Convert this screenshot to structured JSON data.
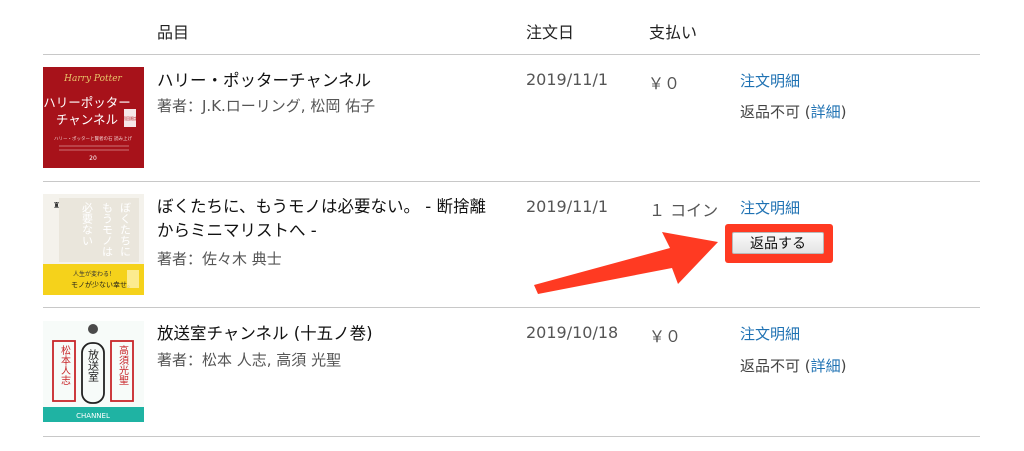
{
  "columns": {
    "item": "品目",
    "order_date": "注文日",
    "payment": "支払い"
  },
  "orders": [
    {
      "title": "ハリー・ポッターチャンネル",
      "author": "著者：J.K.ローリング, 松岡 佑子",
      "date": "2019/11/1",
      "payment": "￥０",
      "order_detail_link": "注文明細",
      "return_status": "返品不可",
      "paren_open": "(",
      "detail_link": "詳細",
      "paren_close": ")",
      "cover": {
        "logo": "Harry Potter",
        "title_line1": "ハリーポッター",
        "title_line2": "チャンネル",
        "seal": "初回限定",
        "small_text": "ハリー・ポッターと賢者の石 読み上げ",
        "footer": "20"
      }
    },
    {
      "title_line1": "ぼくたちに、もうモノは必要ない。 - 断捨離",
      "title_line2": "からミニマリストへ -",
      "author": "著者：佐々木 典士",
      "date": "2019/11/1",
      "payment": "１ コイン",
      "order_detail_link": "注文明細",
      "return_button": "返品する",
      "cover": {
        "vertical_text_1": "ぼくたちに",
        "vertical_text_2": "もうモノは",
        "vertical_text_3": "必要ない",
        "band_text_1": "人生が変わる！",
        "band_text_2": "モノが少ない幸せ。"
      }
    },
    {
      "title": "放送室チャンネル (十五ノ巻)",
      "author": "著者：松本 人志, 高須 光聖",
      "date": "2019/10/18",
      "payment": "￥０",
      "order_detail_link": "注文明細",
      "return_status": "返品不可",
      "paren_open": "(",
      "detail_link": "詳細",
      "paren_close": ")",
      "cover": {
        "left_name": "松本人志",
        "center_title": "放送室",
        "right_name": "高須光聖",
        "footer": "CHANNEL"
      }
    }
  ],
  "colors": {
    "link": "#1f72b3",
    "highlight": "#ff3a22",
    "arrow": "#ff3a22"
  }
}
